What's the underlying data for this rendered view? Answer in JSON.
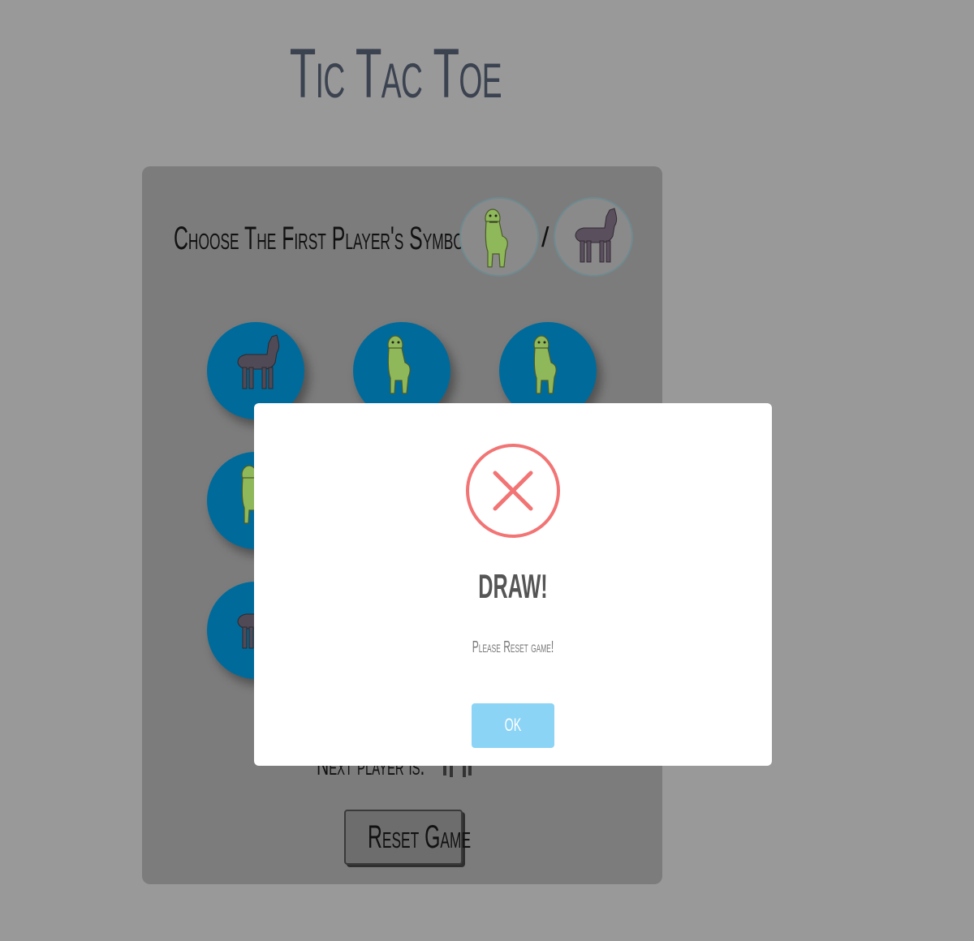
{
  "app": {
    "title": "Tic Tac Toe"
  },
  "chooser": {
    "label": "Choose  The First Player's Symbol",
    "separator": "/",
    "options": [
      {
        "name": "green-llama",
        "icon": "green-llama-icon"
      },
      {
        "name": "brown-alpaca",
        "icon": "alpaca-icon"
      }
    ]
  },
  "board": {
    "cells": [
      {
        "row": 0,
        "col": 0,
        "symbol": "alpaca"
      },
      {
        "row": 0,
        "col": 1,
        "symbol": "green-llama"
      },
      {
        "row": 0,
        "col": 2,
        "symbol": "green-llama"
      },
      {
        "row": 1,
        "col": 0,
        "symbol": "green-llama"
      },
      {
        "row": 2,
        "col": 0,
        "symbol": "alpaca"
      }
    ],
    "cell_color": "#006b9b"
  },
  "status": {
    "next_player_label": "Next player is:"
  },
  "controls": {
    "reset_label": "Reset Game"
  },
  "modal": {
    "icon": "error-x-icon",
    "icon_color": "#f27474",
    "title": "DRAW!",
    "text": "Please Reset game!",
    "ok_label": "OK",
    "ok_color": "#8cd4f5"
  }
}
